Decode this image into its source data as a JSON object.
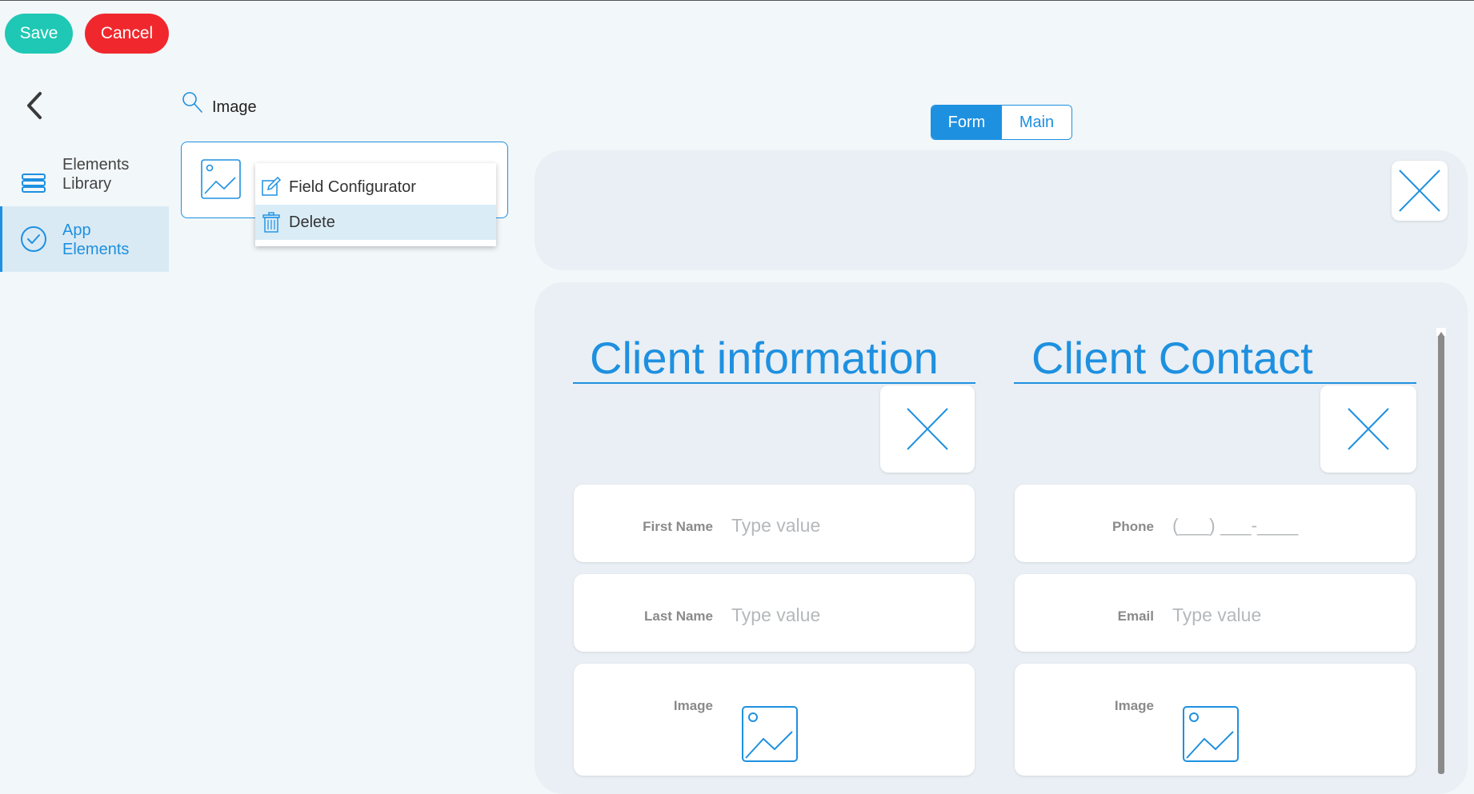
{
  "toolbar": {
    "save_label": "Save",
    "cancel_label": "Cancel"
  },
  "nav": {
    "back_icon": "chevron-left-icon",
    "items": [
      {
        "label": "Elements Library",
        "icon": "stack-icon",
        "active": false
      },
      {
        "label": "App Elements",
        "icon": "check-circle-icon",
        "active": true
      }
    ]
  },
  "search": {
    "icon": "search-icon",
    "value": "Image"
  },
  "context_menu": {
    "items": [
      {
        "label": "Field Configurator",
        "icon": "edit-icon"
      },
      {
        "label": "Delete",
        "icon": "trash-icon"
      }
    ]
  },
  "view_toggle": {
    "options": [
      "Form",
      "Main"
    ],
    "selected": "Form"
  },
  "sections": [
    {
      "title": "Client information",
      "fields": [
        {
          "label": "First Name",
          "placeholder": "Type value"
        },
        {
          "label": "Last Name",
          "placeholder": "Type value"
        },
        {
          "label": "Image",
          "icon": "image-icon"
        }
      ]
    },
    {
      "title": "Client Contact",
      "fields": [
        {
          "label": "Phone",
          "placeholder": "(___) ___-____"
        },
        {
          "label": "Email",
          "placeholder": "Type value"
        },
        {
          "label": "Image",
          "icon": "image-icon"
        }
      ]
    }
  ],
  "colors": {
    "accent": "#1e90e0",
    "save": "#1fc8b4",
    "cancel": "#f0282d",
    "background": "#f2f7fa",
    "panel": "#e9eff4"
  }
}
